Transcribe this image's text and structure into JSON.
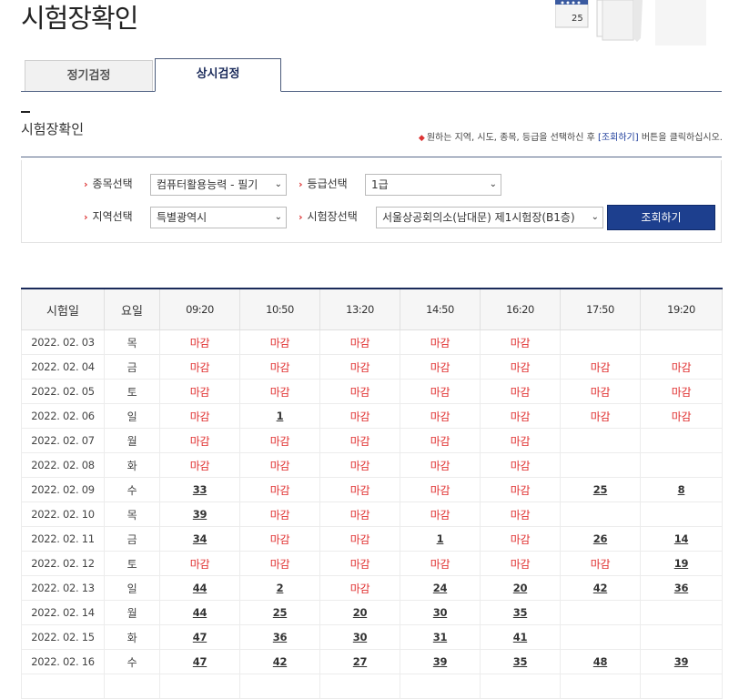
{
  "page": {
    "title": "시험장확인"
  },
  "tabs": [
    {
      "label": "정기검정"
    },
    {
      "label": "상시검정"
    }
  ],
  "section": {
    "title": "시험장확인",
    "hint_prefix": "원하는 지역, 시도, 종목, 등급을 선택하신 후",
    "hint_link": "[조회하기]",
    "hint_suffix": "버튼을 클릭하십시오."
  },
  "form": {
    "subject_label": "종목선택",
    "subject_value": "컴퓨터활용능력 - 필기",
    "grade_label": "등급선택",
    "grade_value": "1급",
    "region_label": "지역선택",
    "region_value": "특별광역시",
    "center_label": "시험장선택",
    "center_value": "서울상공회의소(남대문) 제1시험장(B1층)",
    "search_button": "조회하기"
  },
  "table": {
    "headers": [
      "시험일",
      "요일",
      "09:20",
      "10:50",
      "13:20",
      "14:50",
      "16:20",
      "17:50",
      "19:20"
    ],
    "rows": [
      [
        "2022. 02. 03",
        "목",
        "마감",
        "마감",
        "마감",
        "마감",
        "마감",
        "",
        ""
      ],
      [
        "2022. 02. 04",
        "금",
        "마감",
        "마감",
        "마감",
        "마감",
        "마감",
        "마감",
        "마감"
      ],
      [
        "2022. 02. 05",
        "토",
        "마감",
        "마감",
        "마감",
        "마감",
        "마감",
        "마감",
        "마감"
      ],
      [
        "2022. 02. 06",
        "일",
        "마감",
        "1",
        "마감",
        "마감",
        "마감",
        "마감",
        "마감"
      ],
      [
        "2022. 02. 07",
        "월",
        "마감",
        "마감",
        "마감",
        "마감",
        "마감",
        "",
        ""
      ],
      [
        "2022. 02. 08",
        "화",
        "마감",
        "마감",
        "마감",
        "마감",
        "마감",
        "",
        ""
      ],
      [
        "2022. 02. 09",
        "수",
        "33",
        "마감",
        "마감",
        "마감",
        "마감",
        "25",
        "8"
      ],
      [
        "2022. 02. 10",
        "목",
        "39",
        "마감",
        "마감",
        "마감",
        "마감",
        "",
        ""
      ],
      [
        "2022. 02. 11",
        "금",
        "34",
        "마감",
        "마감",
        "1",
        "마감",
        "26",
        "14"
      ],
      [
        "2022. 02. 12",
        "토",
        "마감",
        "마감",
        "마감",
        "마감",
        "마감",
        "마감",
        "19"
      ],
      [
        "2022. 02. 13",
        "일",
        "44",
        "2",
        "마감",
        "24",
        "20",
        "42",
        "36"
      ],
      [
        "2022. 02. 14",
        "월",
        "44",
        "25",
        "20",
        "30",
        "35",
        "",
        ""
      ],
      [
        "2022. 02. 15",
        "화",
        "47",
        "36",
        "30",
        "31",
        "41",
        "",
        ""
      ],
      [
        "2022. 02. 16",
        "수",
        "47",
        "42",
        "27",
        "39",
        "35",
        "48",
        "39"
      ],
      [
        "",
        "",
        "",
        "",
        "",
        "",
        "",
        "",
        ""
      ]
    ]
  },
  "hero": {
    "calendar_number": "25"
  }
}
